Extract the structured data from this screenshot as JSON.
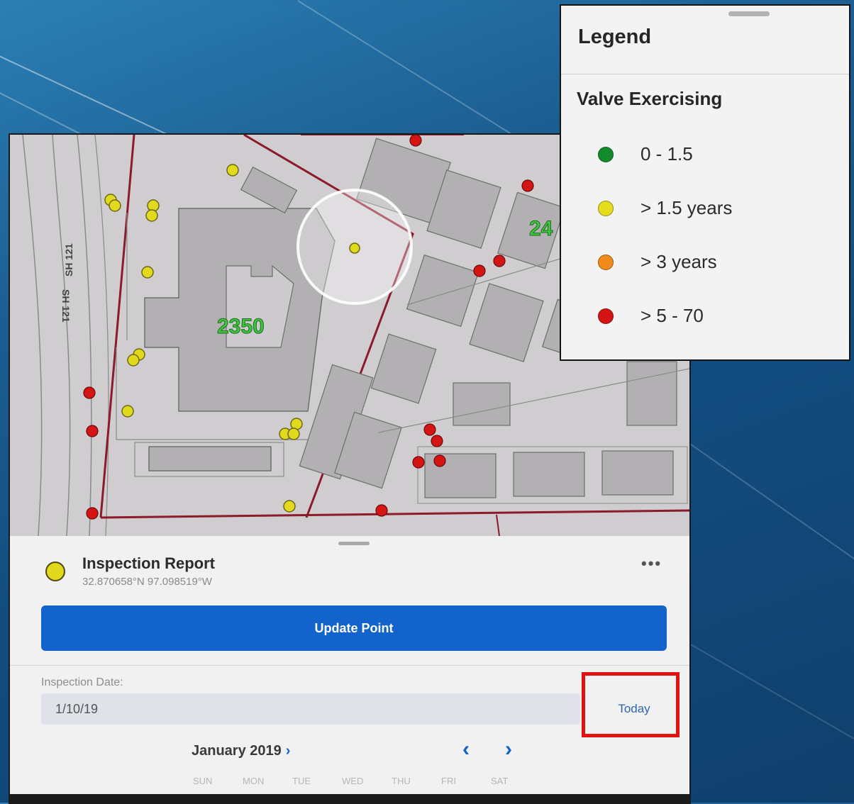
{
  "map": {
    "road_label_1": "SH 121",
    "road_label_2": "SH 121",
    "building_label": "2350",
    "building_label_partial": "24"
  },
  "sheet": {
    "title": "Inspection Report",
    "coordinates": "32.870658°N  97.098519°W",
    "more_label": "•••",
    "update_button": "Update Point",
    "date_label": "Inspection Date:",
    "date_value": "1/10/19",
    "today_button": "Today",
    "month_label": "January 2019",
    "month_chevron": "›",
    "nav_prev": "‹",
    "nav_next": "›",
    "weekdays": [
      "SUN",
      "MON",
      "TUE",
      "WED",
      "THU",
      "FRI",
      "SAT"
    ]
  },
  "legend": {
    "title": "Legend",
    "subtitle": "Valve Exercising",
    "items": [
      {
        "label": "0 - 1.5",
        "color": "#138a2c"
      },
      {
        "label": "> 1.5 years",
        "color": "#e4dc1c"
      },
      {
        "label": "> 3 years",
        "color": "#f28a1a"
      },
      {
        "label": "> 5 - 70",
        "color": "#d51414"
      }
    ]
  },
  "colors": {
    "accent": "#1363cc",
    "highlight": "#e01212",
    "valve_yellow": "#e1d91e",
    "valve_red": "#d51414",
    "building_label": "#3fc43f"
  }
}
